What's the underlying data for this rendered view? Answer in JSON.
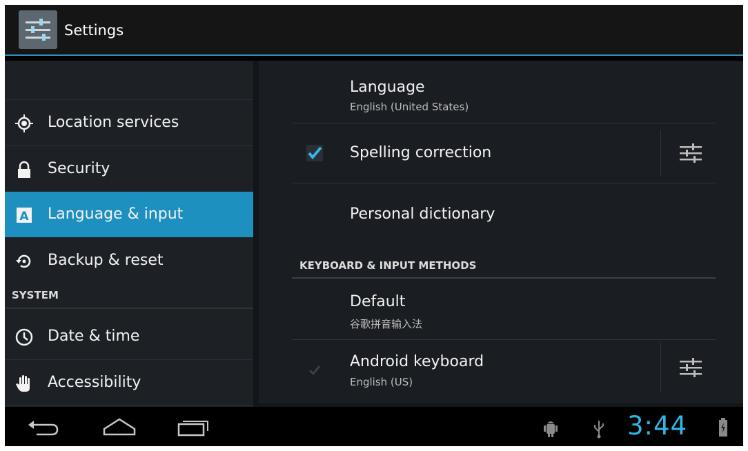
{
  "app": {
    "title": "Settings"
  },
  "sidebar": {
    "items": [
      {
        "label": "Location services",
        "icon": "location-icon",
        "active": false
      },
      {
        "label": "Security",
        "icon": "lock-icon",
        "active": false
      },
      {
        "label": "Language & input",
        "icon": "keyboard-a-icon",
        "active": true
      },
      {
        "label": "Backup & reset",
        "icon": "restore-icon",
        "active": false
      }
    ],
    "section_header": "SYSTEM",
    "system_items": [
      {
        "label": "Date & time",
        "icon": "clock-icon"
      },
      {
        "label": "Accessibility",
        "icon": "hand-icon"
      }
    ]
  },
  "content": {
    "language": {
      "title": "Language",
      "subtitle": "English (United States)"
    },
    "spelling": {
      "title": "Spelling correction",
      "checked": true
    },
    "dictionary": {
      "title": "Personal dictionary"
    },
    "section_header": "KEYBOARD & INPUT METHODS",
    "default": {
      "title": "Default",
      "subtitle": "谷歌拼音输入法"
    },
    "android_keyboard": {
      "title": "Android keyboard",
      "subtitle": "English (US)",
      "checked": true
    }
  },
  "statusbar": {
    "time": "3:44"
  },
  "colors": {
    "accent": "#33b5e5",
    "active_item": "#1e90c0"
  }
}
